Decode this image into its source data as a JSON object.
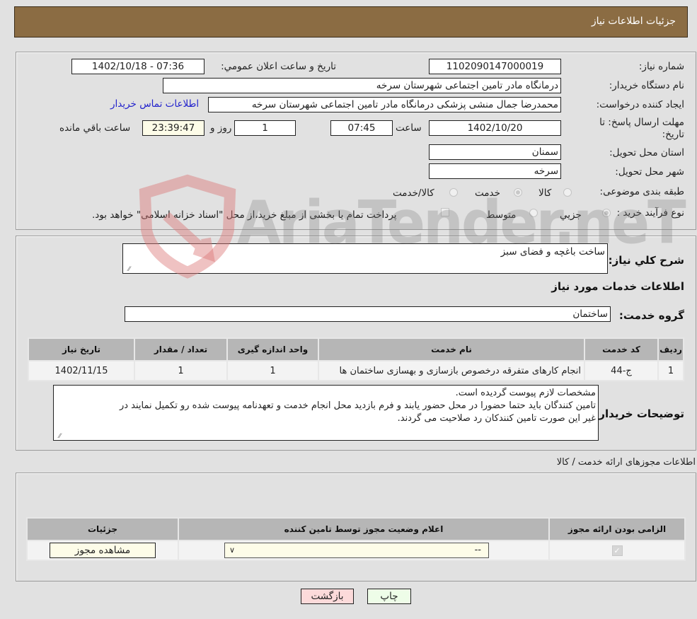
{
  "header": {
    "title": "جزئیات اطلاعات نیاز"
  },
  "details": {
    "need_number_label": "شماره نیاز:",
    "need_number": "1102090147000019",
    "announce_label": "تاريخ و ساعت اعلان عمومي:",
    "announce_value": "1402/10/18 - 07:36",
    "buyer_org_label": "نام دستگاه خريدار:",
    "buyer_org": "درمانگاه مادر تامین اجتماعی شهرستان سرخه",
    "requester_label": "ایجاد کننده درخواست:",
    "requester": "محمدرضا جمال منشی پزشکی درمانگاه مادر تامین اجتماعی شهرستان سرخه",
    "contact_link": "اطلاعات تماس خریدار",
    "deadline_label": "مهلت ارسال پاسخ: تا تاریخ:",
    "deadline_date": "1402/10/20",
    "time_label": "ساعت",
    "deadline_time": "07:45",
    "days_value": "1",
    "days_label": "روز و",
    "remaining_time": "23:39:47",
    "remaining_label": "ساعت باقي مانده",
    "province_label": "استان محل تحویل:",
    "province": "سمنان",
    "city_label": "شهر محل تحویل:",
    "city": "سرخه",
    "category_label": "طبقه بندی موضوعی:",
    "category_options": [
      {
        "label": "کالا",
        "checked": false
      },
      {
        "label": "خدمت",
        "checked": true
      },
      {
        "label": "کالا/خدمت",
        "checked": false
      }
    ],
    "process_label": "نوع فرآیند خرید :",
    "process_options": [
      {
        "label": "جزيي",
        "checked": true
      },
      {
        "label": "متوسط",
        "checked": false
      }
    ],
    "treasury_note": "پرداخت تمام یا بخشی از مبلغ خرید،از محل \"اسناد خزانه اسلامی\" خواهد بود."
  },
  "services": {
    "summary_label": "شرح کلي نياز:",
    "summary": "ساخت باغچه و فضای سبز",
    "section_title": "اطلاعات خدمات مورد نياز",
    "group_label": "گروه خدمت:",
    "group": "ساختمان",
    "table": {
      "headers": [
        "رديف",
        "کد خدمت",
        "نام خدمت",
        "واحد اندازه گيری",
        "تعداد / مقدار",
        "تاريخ نياز"
      ],
      "rows": [
        [
          "1",
          "ج-44",
          "انجام کارهای متفرقه درخصوص بازسازی و بهسازی ساختمان ها",
          "1",
          "1",
          "1402/11/15"
        ]
      ]
    },
    "buyer_notes_label": "توضیحات خریدار:",
    "buyer_notes": [
      "مشخصات لازم پیوست گردیده است.",
      "تامین کنندگان باید حتما حضورا در محل حضور یابند و فرم بازدید محل انجام خدمت و تعهدنامه پیوست شده رو تکمیل نمایند در",
      "غیر این صورت تامین کنندکان رد صلاحیت می گردند."
    ]
  },
  "licenses": {
    "section_title": "اطلاعات مجوزهای ارائه خدمت / کالا",
    "headers": [
      "الزامی بودن ارائه مجوز",
      "اعلام وضعیت مجوز توسط تامین کننده",
      "جزئیات"
    ],
    "row": {
      "required_checked": true,
      "status_selected": "--",
      "details_button": "مشاهده مجوز"
    }
  },
  "actions": {
    "print": "چاپ",
    "back": "بازگشت"
  },
  "watermark": {
    "text": "AriaTender.neT"
  },
  "colors": {
    "header_bg": "#8b6c43",
    "back_button_bg": "#fcdada",
    "print_button_bg": "#eefde8",
    "link": "#2222cc"
  }
}
